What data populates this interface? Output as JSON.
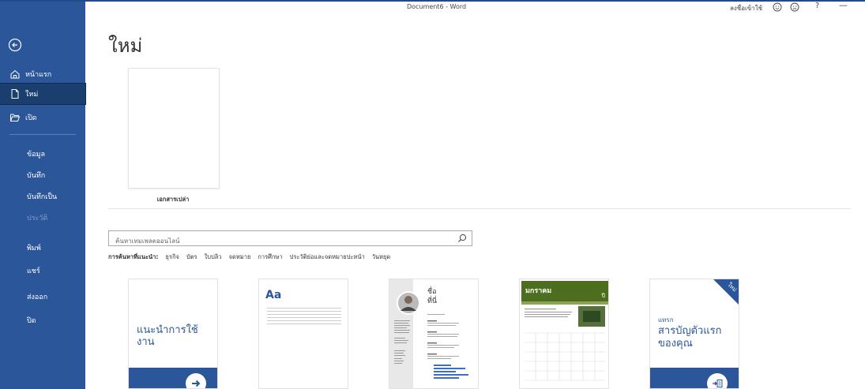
{
  "window": {
    "doc_title": "Document6 - Word",
    "signin": "ลงชื่อเข้าใช้",
    "help": "?",
    "minimize": "—"
  },
  "sidebar": {
    "items": [
      {
        "label": "หน้าแรก"
      },
      {
        "label": "ใหม่"
      },
      {
        "label": "เปิด"
      },
      {
        "label": "ข้อมูล"
      },
      {
        "label": "บันทึก"
      },
      {
        "label": "บันทึกเป็น"
      },
      {
        "label": "ประวัติ"
      },
      {
        "label": "พิมพ์"
      },
      {
        "label": "แชร์"
      },
      {
        "label": "ส่งออก"
      },
      {
        "label": "ปิด"
      }
    ]
  },
  "main": {
    "title": "ใหม่",
    "blank_label": "เอกสารเปล่า",
    "search_placeholder": "ค้นหาเทมเพลตออนไลน์",
    "suggest_label": "การค้นหาที่แนะนำ:",
    "suggestions": [
      "ธุรกิจ",
      "บัตร",
      "ใบปลิว",
      "จดหมาย",
      "การศึกษา",
      "ประวัติย่อและจดหมายปะหน้า",
      "วันหยุด"
    ],
    "tour_title": "แนะนำการใช้งาน",
    "aa_text": "Aa",
    "resume_name": "ชื่อ",
    "resume_last": "ที่นี่",
    "calendar_month": "มกราคม",
    "calendar_num": "ปี",
    "toc_small": "แทรก",
    "toc_title": "สารบัญตัวแรกของคุณ",
    "new_badge": "ใหม่"
  }
}
